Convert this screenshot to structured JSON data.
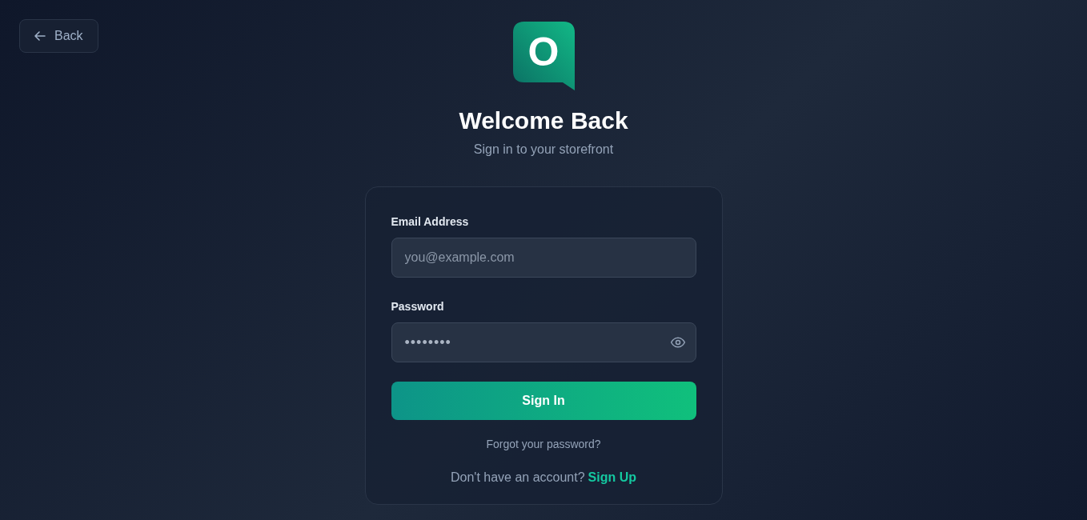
{
  "back_button": {
    "label": "Back"
  },
  "logo": {
    "letter": "O"
  },
  "title": "Welcome Back",
  "subtitle": "Sign in to your storefront",
  "form": {
    "email": {
      "label": "Email Address",
      "placeholder": "you@example.com"
    },
    "password": {
      "label": "Password",
      "value": "••••••••"
    },
    "submit": "Sign In",
    "forgot_link": "Forgot your password?",
    "signup_prompt": "Don't have an account?",
    "signup_link": "Sign Up"
  }
}
